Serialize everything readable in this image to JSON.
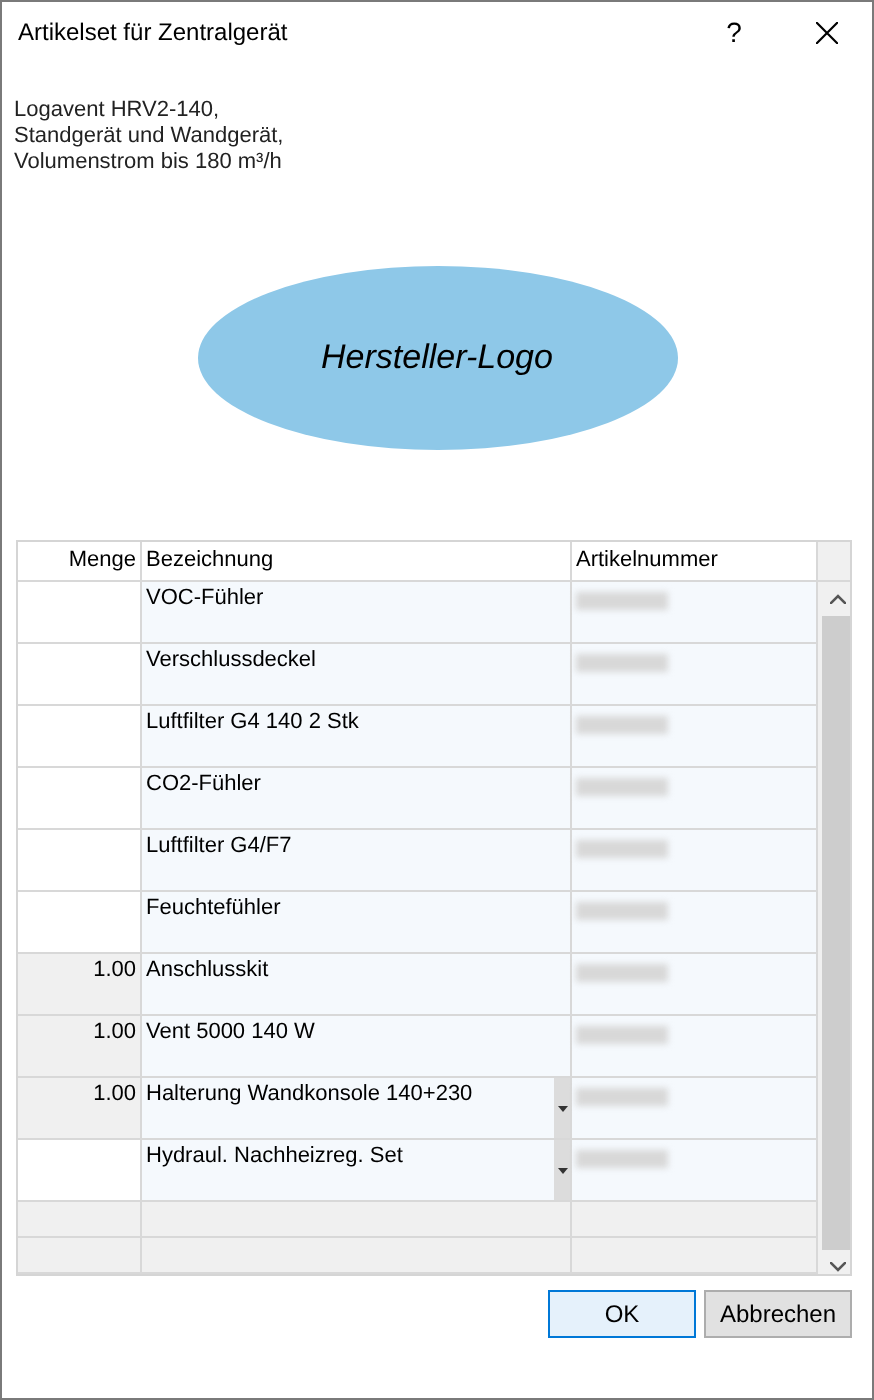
{
  "window": {
    "title": "Artikelset für Zentralgerät",
    "help": "?"
  },
  "description": [
    "Logavent HRV2-140,",
    "Standgerät und Wandgerät,",
    "Volumenstrom bis 180 m³/h"
  ],
  "logo": {
    "label": "Hersteller-Logo"
  },
  "table": {
    "columns": [
      "Menge",
      "Bezeichnung",
      "Artikelnummer"
    ],
    "rows": [
      {
        "bezeichnung": "VOC-Fühler",
        "dropdown": false
      },
      {
        "bezeichnung": "Verschlussdeckel",
        "dropdown": false
      },
      {
        "bezeichnung": "Luftfilter G4 140 2 Stk",
        "dropdown": false
      },
      {
        "bezeichnung": "CO2-Fühler",
        "dropdown": false
      },
      {
        "bezeichnung": "Luftfilter G4/F7",
        "dropdown": false
      },
      {
        "bezeichnung": "Feuchtefühler",
        "dropdown": false
      },
      {
        "menge": "1.00",
        "bezeichnung": "Anschlusskit",
        "dropdown": false
      },
      {
        "menge": "1.00",
        "bezeichnung": "Vent 5000 140 W",
        "dropdown": false
      },
      {
        "menge": "1.00",
        "bezeichnung": "Halterung Wandkonsole 140+230",
        "dropdown": true
      },
      {
        "bezeichnung": "Hydraul. Nachheizreg. Set",
        "dropdown": true
      }
    ]
  },
  "buttons": [
    {
      "label": "OK",
      "focused": true
    },
    {
      "label": "Abbrechen",
      "focused": false
    }
  ]
}
